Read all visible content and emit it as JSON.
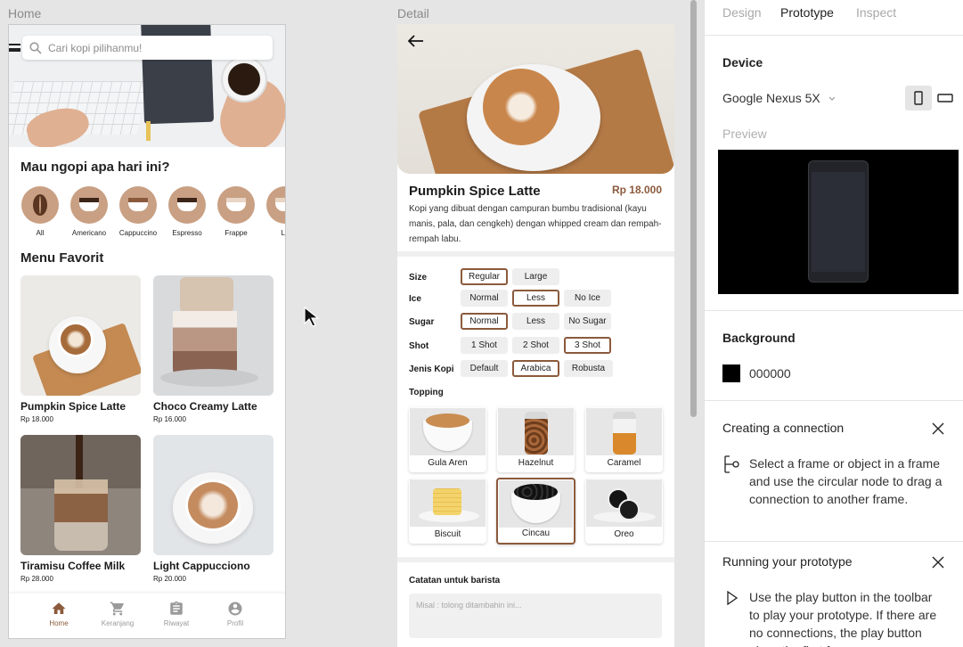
{
  "frames": {
    "home_label": "Home",
    "detail_label": "Detail"
  },
  "home": {
    "search_placeholder": "Cari kopi pilihanmu!",
    "question_title": "Mau ngopi apa hari ini?",
    "categories": [
      "All",
      "Americano",
      "Cappuccino",
      "Espresso",
      "Frappe",
      "La"
    ],
    "favorites_title": "Menu Favorit",
    "menu": [
      {
        "name": "Pumpkin Spice Latte",
        "price": "Rp 18.000"
      },
      {
        "name": "Choco Creamy Latte",
        "price": "Rp 16.000"
      },
      {
        "name": "Tiramisu Coffee Milk",
        "price": "Rp 28.000"
      },
      {
        "name": "Light Cappucciono",
        "price": "Rp 20.000"
      }
    ],
    "nav": [
      {
        "label": "Home",
        "icon": "home-icon",
        "active": true
      },
      {
        "label": "Keranjang",
        "icon": "cart-icon",
        "active": false
      },
      {
        "label": "Riwayat",
        "icon": "clipboard-icon",
        "active": false
      },
      {
        "label": "Profil",
        "icon": "account-icon",
        "active": false
      }
    ]
  },
  "detail": {
    "name": "Pumpkin Spice Latte",
    "price": "Rp 18.000",
    "description": "Kopi yang dibuat dengan campuran bumbu tradisional (kayu manis, pala, dan cengkeh) dengan whipped cream dan rempah-rempah labu.",
    "options": {
      "size": {
        "label": "Size",
        "choices": [
          "Regular",
          "Large"
        ],
        "selected": "Regular"
      },
      "ice": {
        "label": "Ice",
        "choices": [
          "Normal",
          "Less",
          "No Ice"
        ],
        "selected": "Less"
      },
      "sugar": {
        "label": "Sugar",
        "choices": [
          "Normal",
          "Less",
          "No Sugar"
        ],
        "selected": "Normal"
      },
      "shot": {
        "label": "Shot",
        "choices": [
          "1 Shot",
          "2 Shot",
          "3 Shot"
        ],
        "selected": "3 Shot"
      },
      "bean": {
        "label": "Jenis Kopi",
        "choices": [
          "Default",
          "Arabica",
          "Robusta"
        ],
        "selected": "Arabica"
      }
    },
    "topping_label": "Topping",
    "toppings": [
      "Gula Aren",
      "Hazelnut",
      "Caramel",
      "Biscuit",
      "Cincau",
      "Oreo"
    ],
    "topping_selected": "Cincau",
    "notes_label": "Catatan untuk barista",
    "notes_placeholder": "Misal : tolong ditambahin ini..."
  },
  "panel": {
    "tabs": [
      "Design",
      "Prototype",
      "Inspect"
    ],
    "active_tab": "Prototype",
    "device_title": "Device",
    "device_value": "Google Nexus 5X",
    "preview_label": "Preview",
    "background_title": "Background",
    "background_hex": "000000",
    "background_color": "#000000",
    "help": [
      {
        "title": "Creating a connection",
        "icon": "connection-icon",
        "text": "Select a frame or object in a frame and use the circular node to drag a connection to another frame."
      },
      {
        "title": "Running your prototype",
        "icon": "play-icon",
        "text": "Use the play button in the toolbar to play your prototype. If there are no connections, the play button plays the first frame."
      }
    ]
  },
  "colors": {
    "accent": "#8b5a3c",
    "category_circle": "#c9a083",
    "canvas": "#e5e5e5"
  }
}
